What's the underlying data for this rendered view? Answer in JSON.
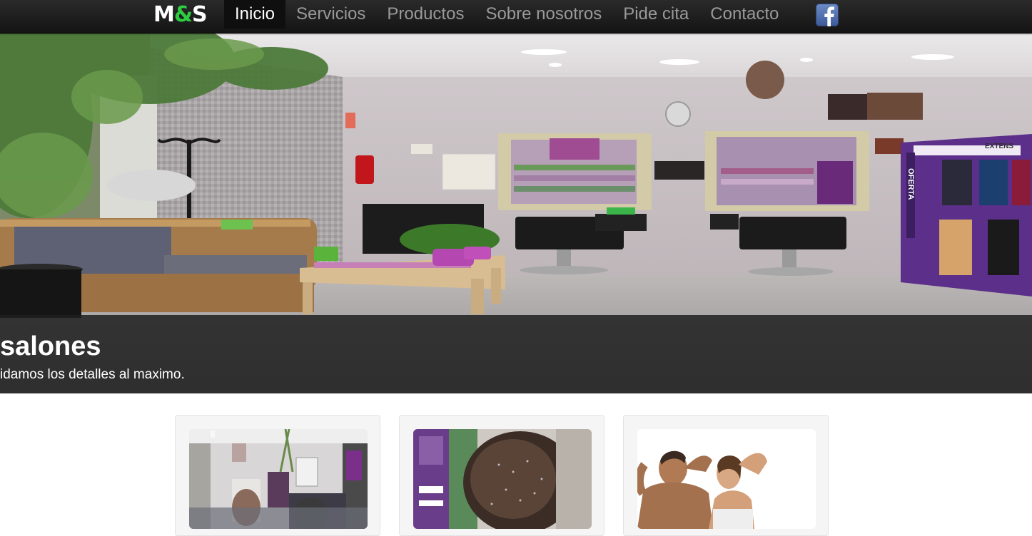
{
  "brand": {
    "part1": "M",
    "part2": "&",
    "part3": "S",
    "accent_color": "#2ecc40"
  },
  "nav": {
    "items": [
      {
        "label": "Inicio",
        "active": true
      },
      {
        "label": "Servicios",
        "active": false
      },
      {
        "label": "Productos",
        "active": false
      },
      {
        "label": "Sobre nosotros",
        "active": false
      },
      {
        "label": "Pide cita",
        "active": false
      },
      {
        "label": "Contacto",
        "active": false
      }
    ],
    "social_icon": "facebook-icon"
  },
  "hero": {
    "title": "salones",
    "subtitle": "idamos los detalles al maximo.",
    "sign_text": "OFERTA",
    "banner_text": "EXTENS"
  },
  "thumbnails": [
    {
      "name": "salon-interior-photo"
    },
    {
      "name": "hairstyle-photo"
    },
    {
      "name": "couple-photo"
    }
  ]
}
